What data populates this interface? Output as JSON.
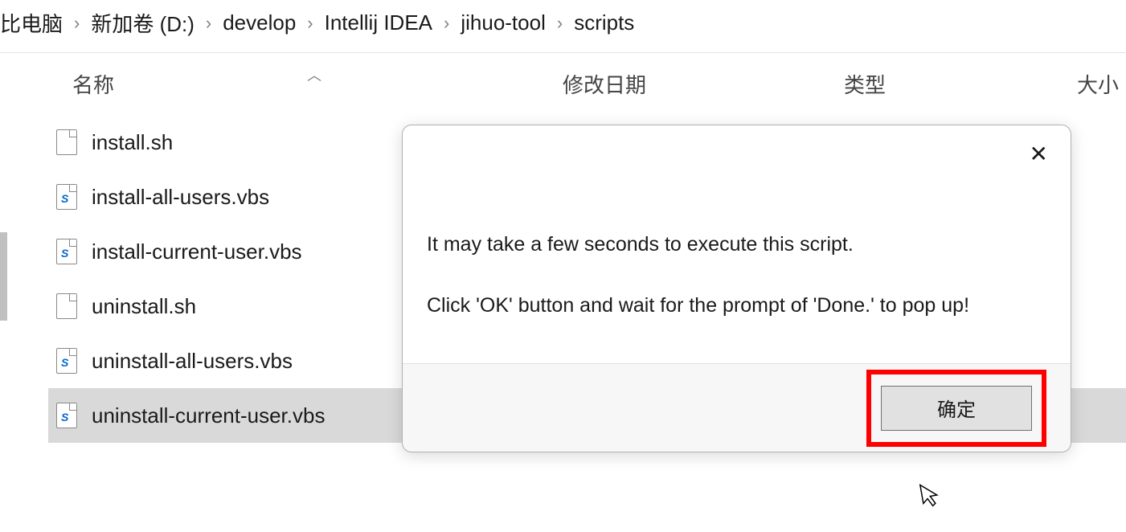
{
  "breadcrumb": {
    "items": [
      "比电脑",
      "新加卷 (D:)",
      "develop",
      "Intellij IDEA",
      "jihuo-tool",
      "scripts"
    ]
  },
  "columns": {
    "name": "名称",
    "date": "修改日期",
    "type": "类型",
    "size": "大小"
  },
  "files": [
    {
      "name": "install.sh",
      "icon": "generic"
    },
    {
      "name": "install-all-users.vbs",
      "icon": "vbs"
    },
    {
      "name": "install-current-user.vbs",
      "icon": "vbs"
    },
    {
      "name": "uninstall.sh",
      "icon": "generic"
    },
    {
      "name": "uninstall-all-users.vbs",
      "icon": "vbs"
    },
    {
      "name": "uninstall-current-user.vbs",
      "icon": "vbs"
    }
  ],
  "dialog": {
    "line1": "It may take a few seconds to execute this script.",
    "line2": "Click 'OK' button and wait for the prompt of 'Done.' to pop up!",
    "ok_label": "确定"
  }
}
